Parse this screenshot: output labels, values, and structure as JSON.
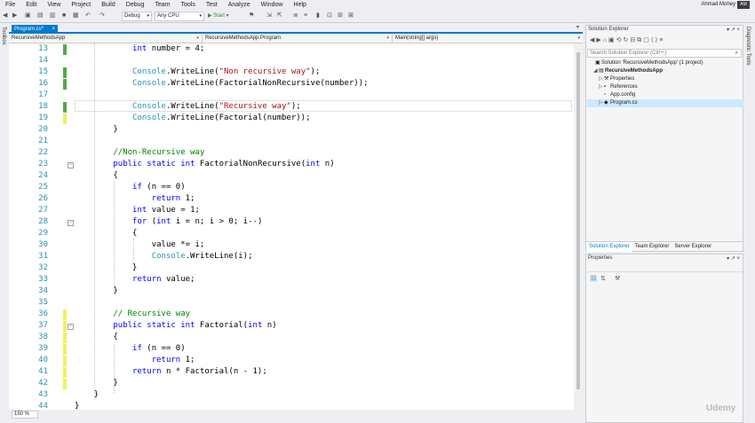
{
  "menu": [
    "File",
    "Edit",
    "View",
    "Project",
    "Build",
    "Debug",
    "Team",
    "Tools",
    "Test",
    "Analyze",
    "Window",
    "Help"
  ],
  "user": {
    "name": "Ahmad Mohey",
    "initials": "AM"
  },
  "toolbar": {
    "config": "Debug",
    "platform": "Any CPU",
    "start_label": "▶ Start ▾"
  },
  "left_strip_label": "Toolbox",
  "right_strip_label": "Diagnostic Tools",
  "tab": {
    "label": "Program.cs*",
    "close": "×"
  },
  "nav": {
    "project": "RecursiveMethodsApp",
    "class": "RecursiveMethodsApp.Program",
    "member": "Main(string[] args)"
  },
  "code_lines": [
    {
      "n": "13",
      "t": "            int number = 4;"
    },
    {
      "n": "14",
      "t": ""
    },
    {
      "n": "15",
      "t": "            Console.WriteLine(\"Non recursive way\");"
    },
    {
      "n": "16",
      "t": "            Console.WriteLine(FactorialNonRecursive(number));"
    },
    {
      "n": "17",
      "t": ""
    },
    {
      "n": "18",
      "t": "            Console.WriteLine(\"Recursive way\");"
    },
    {
      "n": "19",
      "t": "            Console.WriteLine(Factorial(number));"
    },
    {
      "n": "20",
      "t": "        }"
    },
    {
      "n": "21",
      "t": ""
    },
    {
      "n": "22",
      "t": "        //Non-Recursive way"
    },
    {
      "n": "23",
      "t": "        public static int FactorialNonRecursive(int n)"
    },
    {
      "n": "24",
      "t": "        {"
    },
    {
      "n": "25",
      "t": "            if (n == 0)"
    },
    {
      "n": "26",
      "t": "                return 1;"
    },
    {
      "n": "27",
      "t": "            int value = 1;"
    },
    {
      "n": "28",
      "t": "            for (int i = n; i > 0; i--)"
    },
    {
      "n": "29",
      "t": "            {"
    },
    {
      "n": "30",
      "t": "                value *= i;"
    },
    {
      "n": "31",
      "t": "                Console.WriteLine(i);"
    },
    {
      "n": "32",
      "t": "            }"
    },
    {
      "n": "33",
      "t": "            return value;"
    },
    {
      "n": "34",
      "t": "        }"
    },
    {
      "n": "35",
      "t": ""
    },
    {
      "n": "36",
      "t": "        // Recursive way"
    },
    {
      "n": "37",
      "t": "        public static int Factorial(int n)"
    },
    {
      "n": "38",
      "t": "        {"
    },
    {
      "n": "39",
      "t": "            if (n == 0)"
    },
    {
      "n": "40",
      "t": "                return 1;"
    },
    {
      "n": "41",
      "t": "            return n * Factorial(n - 1);"
    },
    {
      "n": "42",
      "t": "        }"
    },
    {
      "n": "43",
      "t": "    }"
    },
    {
      "n": "44",
      "t": "}"
    }
  ],
  "zoom": "150 %",
  "solution_explorer": {
    "title": "Solution Explorer",
    "controls": "▾ ↗ ×",
    "search_placeholder": "Search Solution Explorer (Ctrl+;)",
    "tree": [
      {
        "label": "Solution 'RecursiveMethodsApp' (1 project)",
        "icon": "▣",
        "exp": ""
      },
      {
        "label": "RecursiveMethodsApp",
        "icon": "▤",
        "exp": "◢"
      },
      {
        "label": "Properties",
        "icon": "⚒",
        "exp": "▷"
      },
      {
        "label": "References",
        "icon": "▪",
        "exp": "▷"
      },
      {
        "label": "App.config",
        "icon": "▫",
        "exp": ""
      },
      {
        "label": "Program.cs",
        "icon": "◆",
        "exp": "▷"
      }
    ],
    "tabs": [
      "Solution Explorer",
      "Team Explorer",
      "Server Explorer"
    ]
  },
  "properties": {
    "title": "Properties",
    "controls": "▾ ↗ ×"
  },
  "watermark": "Udemy"
}
